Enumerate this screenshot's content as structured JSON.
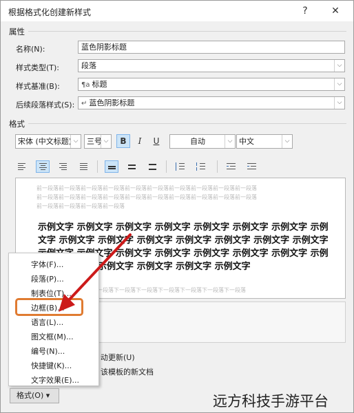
{
  "window": {
    "title": "根据格式化创建新样式",
    "help_label": "?",
    "close_label": "✕"
  },
  "properties": {
    "section_label": "属性",
    "name_label": "名称(N):",
    "name_value": "蓝色阴影标题",
    "style_type_label": "样式类型(T):",
    "style_type_value": "段落",
    "style_based_label": "样式基准(B):",
    "style_based_prefix": "¶a",
    "style_based_value": "标题",
    "next_style_label": "后续段落样式(S):",
    "next_style_prefix": "↵",
    "next_style_value": "蓝色阴影标题"
  },
  "format": {
    "section_label": "格式",
    "font_value": "宋体 (中文标题)",
    "size_value": "三号",
    "bold_label": "B",
    "italic_label": "I",
    "underline_label": "U",
    "color_value": "自动",
    "script_value": "中文"
  },
  "preview": {
    "prev_line1": "前一段落前一段落前一段落前一段落前一段落前一段落前一段落前一段落前一段落前一段落",
    "prev_line2": "前一段落前一段落前一段落前一段落前一段落前一段落前一段落前一段落前一段落前一段落",
    "prev_line3": "前一段落前一段落前一段落前一段落",
    "sample_text": "示例文字 示例文字 示例文字 示例文字 示例文字 示例文字 示例文字 示例文字 示例文字 示例文字 示例文字 示例文字 示例文字 示例文字 示例文字 示例文字 示例文字 示例文字 示例文字 示例文字 示例文字 示例文字 示例文字 示例文字 示例文字 示例文字 示例文字 示例文字",
    "next_line": "段落下一段落下一段落下一段落下一段落下一段落下一段落下一段落下一段落下一段落"
  },
  "options": {
    "auto_update_label": "动更新(U)",
    "new_docs_label": "该模板的新文档"
  },
  "context_menu": {
    "items": [
      {
        "label": "字体(F)..."
      },
      {
        "label": "段落(P)..."
      },
      {
        "label": "制表位(T)..."
      },
      {
        "label": "边框(B)..."
      },
      {
        "label": "语言(L)..."
      },
      {
        "label": "图文框(M)..."
      },
      {
        "label": "编号(N)..."
      },
      {
        "label": "快捷键(K)..."
      },
      {
        "label": "文字效果(E)..."
      }
    ]
  },
  "format_button_label": "格式(O) ▾",
  "watermark": "远方科技手游平台",
  "colors": {
    "highlight": "#e07b31",
    "arrow": "#cc1a1a",
    "accent": "#7eb4ea"
  }
}
